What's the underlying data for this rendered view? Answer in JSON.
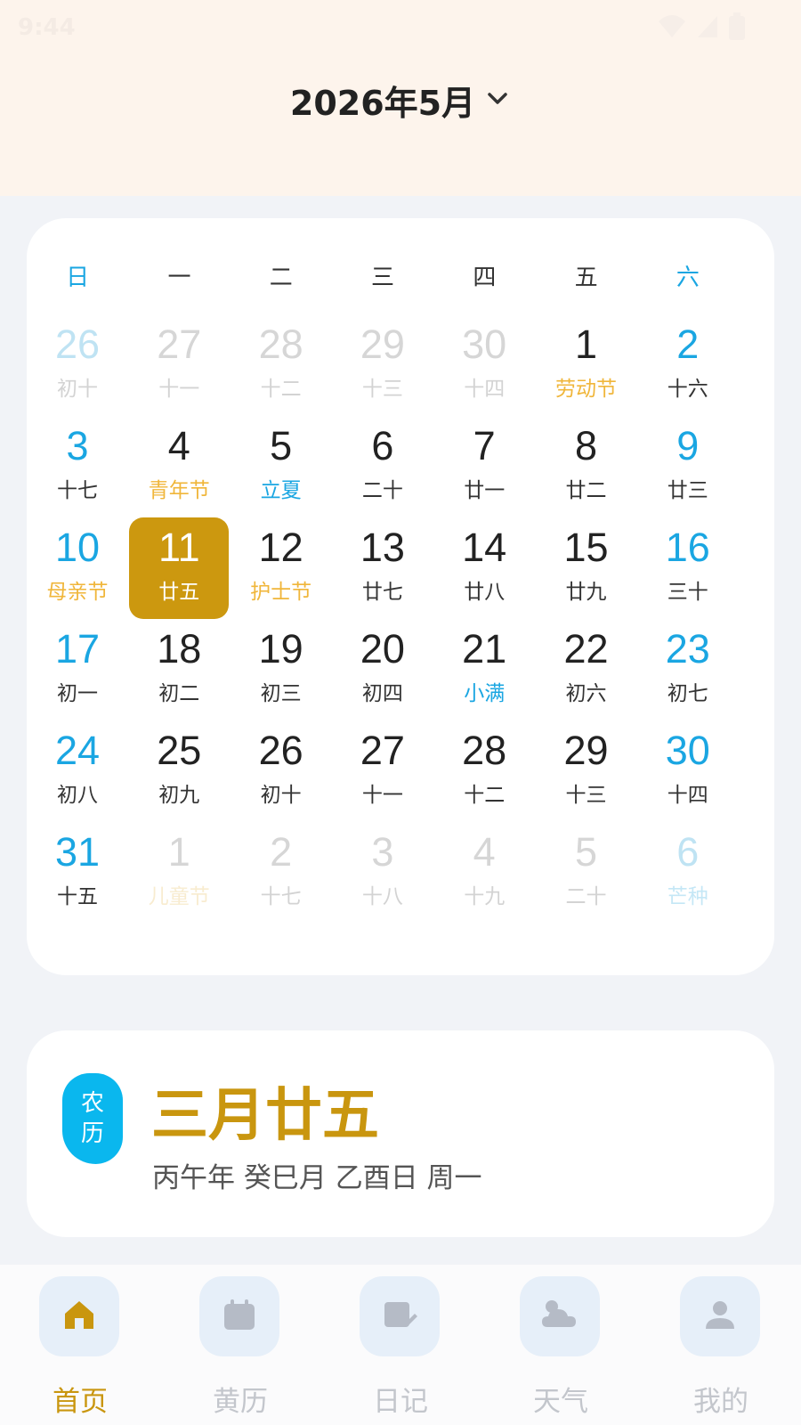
{
  "status_bar": {
    "time": "9:44"
  },
  "header": {
    "month_title": "2026年5月"
  },
  "weekdays": [
    "日",
    "一",
    "二",
    "三",
    "四",
    "五",
    "六"
  ],
  "calendar": {
    "weeks": [
      [
        {
          "day": "26",
          "sub": "初十",
          "dim": true
        },
        {
          "day": "27",
          "sub": "十一",
          "dim": true
        },
        {
          "day": "28",
          "sub": "十二",
          "dim": true
        },
        {
          "day": "29",
          "sub": "十三",
          "dim": true
        },
        {
          "day": "30",
          "sub": "十四",
          "dim": true
        },
        {
          "day": "1",
          "sub": "劳动节",
          "kind": "festival"
        },
        {
          "day": "2",
          "sub": "十六"
        }
      ],
      [
        {
          "day": "3",
          "sub": "十七"
        },
        {
          "day": "4",
          "sub": "青年节",
          "kind": "festival"
        },
        {
          "day": "5",
          "sub": "立夏",
          "kind": "term"
        },
        {
          "day": "6",
          "sub": "二十"
        },
        {
          "day": "7",
          "sub": "廿一"
        },
        {
          "day": "8",
          "sub": "廿二"
        },
        {
          "day": "9",
          "sub": "廿三"
        }
      ],
      [
        {
          "day": "10",
          "sub": "母亲节",
          "kind": "festival"
        },
        {
          "day": "11",
          "sub": "廿五",
          "selected": true
        },
        {
          "day": "12",
          "sub": "护士节",
          "kind": "festival"
        },
        {
          "day": "13",
          "sub": "廿七"
        },
        {
          "day": "14",
          "sub": "廿八"
        },
        {
          "day": "15",
          "sub": "廿九"
        },
        {
          "day": "16",
          "sub": "三十"
        }
      ],
      [
        {
          "day": "17",
          "sub": "初一"
        },
        {
          "day": "18",
          "sub": "初二"
        },
        {
          "day": "19",
          "sub": "初三"
        },
        {
          "day": "20",
          "sub": "初四"
        },
        {
          "day": "21",
          "sub": "小满",
          "kind": "term"
        },
        {
          "day": "22",
          "sub": "初六"
        },
        {
          "day": "23",
          "sub": "初七"
        }
      ],
      [
        {
          "day": "24",
          "sub": "初八"
        },
        {
          "day": "25",
          "sub": "初九"
        },
        {
          "day": "26",
          "sub": "初十"
        },
        {
          "day": "27",
          "sub": "十一"
        },
        {
          "day": "28",
          "sub": "十二"
        },
        {
          "day": "29",
          "sub": "十三"
        },
        {
          "day": "30",
          "sub": "十四"
        }
      ],
      [
        {
          "day": "31",
          "sub": "十五"
        },
        {
          "day": "1",
          "sub": "儿童节",
          "kind": "festival",
          "dim": true
        },
        {
          "day": "2",
          "sub": "十七",
          "dim": true
        },
        {
          "day": "3",
          "sub": "十八",
          "dim": true
        },
        {
          "day": "4",
          "sub": "十九",
          "dim": true
        },
        {
          "day": "5",
          "sub": "二十",
          "dim": true
        },
        {
          "day": "6",
          "sub": "芒种",
          "kind": "term",
          "dim": true
        }
      ]
    ]
  },
  "lunar": {
    "badge_line1": "农",
    "badge_line2": "历",
    "date": "三月廿五",
    "ganzhi": "丙午年 癸巳月 乙酉日 周一"
  },
  "nav": [
    {
      "label": "首页",
      "icon": "home-icon",
      "active": true
    },
    {
      "label": "黄历",
      "icon": "calendar-icon"
    },
    {
      "label": "日记",
      "icon": "diary-icon"
    },
    {
      "label": "天气",
      "icon": "weather-icon"
    },
    {
      "label": "我的",
      "icon": "profile-icon"
    }
  ],
  "colors": {
    "accent_gold": "#cc980f",
    "weekend_blue": "#1aa6e2",
    "festival_yellow": "#f0b63a",
    "header_bg": "#fdf4ec"
  }
}
